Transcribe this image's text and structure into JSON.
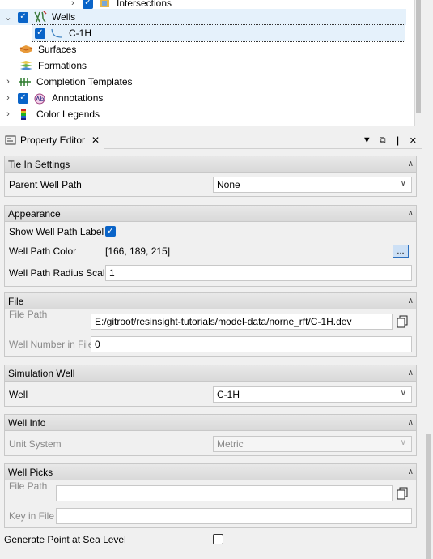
{
  "tree": {
    "items": [
      {
        "label": "Intersections",
        "icon": "intersections-icon"
      },
      {
        "label": "Wells",
        "icon": "wells-icon"
      },
      {
        "label": "C-1H",
        "icon": "well-path-icon"
      },
      {
        "label": "Surfaces",
        "icon": "surfaces-icon"
      },
      {
        "label": "Formations",
        "icon": "formations-icon"
      },
      {
        "label": "Completion Templates",
        "icon": "completion-templates-icon"
      },
      {
        "label": "Annotations",
        "icon": "annotations-icon"
      },
      {
        "label": "Color Legends",
        "icon": "color-legends-icon"
      }
    ]
  },
  "dock": {
    "title": "Property Editor"
  },
  "groups": {
    "tie_in": {
      "title": "Tie In Settings",
      "parent_well_path_label": "Parent Well Path",
      "parent_well_path_value": "None"
    },
    "appearance": {
      "title": "Appearance",
      "show_label": "Show Well Path Label",
      "color_label": "Well Path Color",
      "color_value": "[166, 189, 215]",
      "color_button": "...",
      "radius_label": "Well Path Radius Scale",
      "radius_value": "1"
    },
    "file": {
      "title": "File",
      "path_label": "File Path",
      "path_value": "E:/gitroot/resinsight-tutorials/model-data/norne_rft/C-1H.dev",
      "number_label": "Well Number in File",
      "number_value": "0"
    },
    "sim_well": {
      "title": "Simulation Well",
      "well_label": "Well",
      "well_value": "C-1H"
    },
    "well_info": {
      "title": "Well Info",
      "unit_label": "Unit System",
      "unit_value": "Metric"
    },
    "well_picks": {
      "title": "Well Picks",
      "path_label": "File Path",
      "path_value": "",
      "key_label": "Key in File",
      "key_value": ""
    }
  },
  "footer": {
    "sea_level_label": "Generate Point at Sea Level"
  },
  "colors": {
    "checkbox": "#0a64c8",
    "well_path_color": "#a6bdd7"
  }
}
